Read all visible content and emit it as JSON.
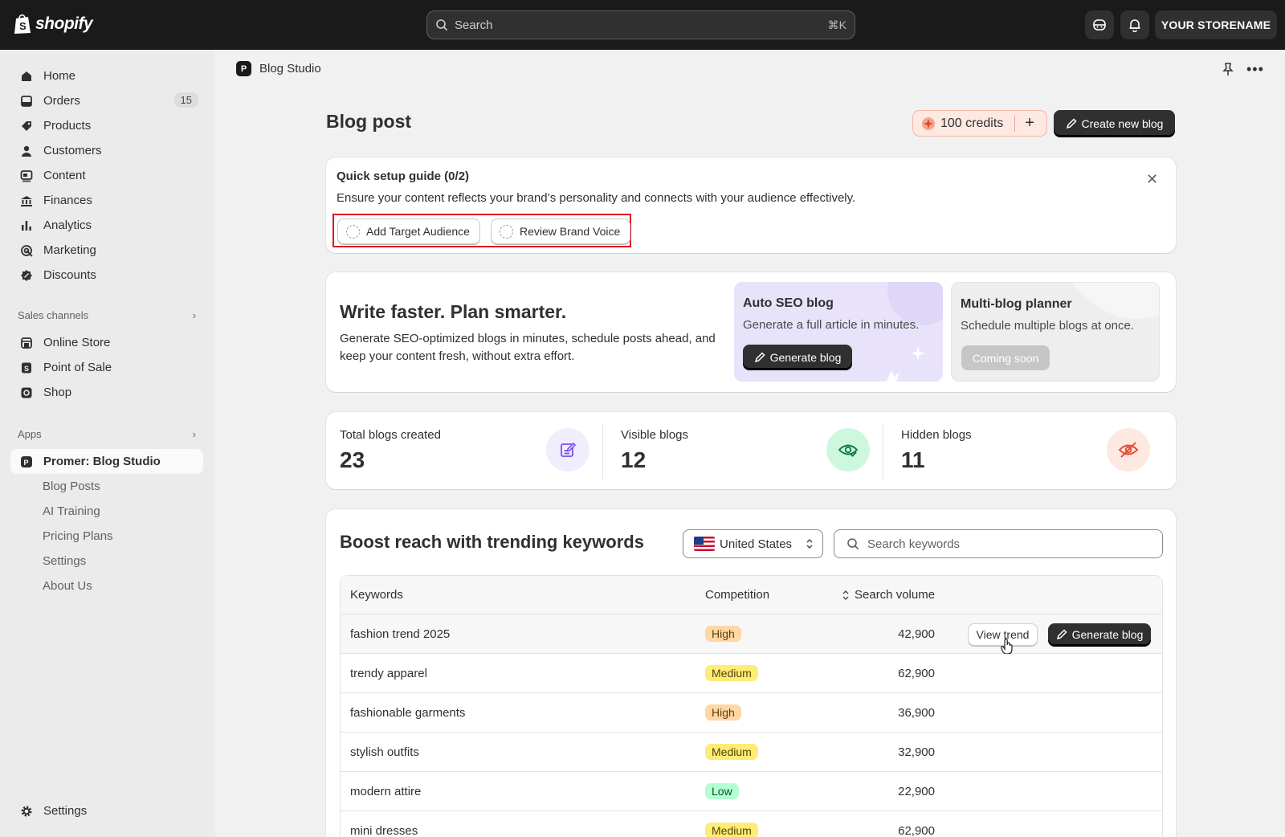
{
  "topbar": {
    "brand": "shopify",
    "search_placeholder": "Search",
    "search_shortcut": "⌘K",
    "store_name": "YOUR STORENAME"
  },
  "sidebar": {
    "items": [
      {
        "label": "Home",
        "icon": "home-icon"
      },
      {
        "label": "Orders",
        "icon": "orders-icon",
        "badge": "15"
      },
      {
        "label": "Products",
        "icon": "tag-icon"
      },
      {
        "label": "Customers",
        "icon": "person-icon"
      },
      {
        "label": "Content",
        "icon": "content-icon"
      },
      {
        "label": "Finances",
        "icon": "bank-icon"
      },
      {
        "label": "Analytics",
        "icon": "bar-chart-icon"
      },
      {
        "label": "Marketing",
        "icon": "target-icon"
      },
      {
        "label": "Discounts",
        "icon": "discount-icon"
      }
    ],
    "sales_channels_label": "Sales channels",
    "channels": [
      {
        "label": "Online Store",
        "icon": "store-icon"
      },
      {
        "label": "Point of Sale",
        "icon": "pos-icon"
      },
      {
        "label": "Shop",
        "icon": "shop-icon"
      }
    ],
    "apps_label": "Apps",
    "app_active": "Promer: Blog Studio",
    "app_sub": [
      "Blog Posts",
      "AI Training",
      "Pricing Plans",
      "Settings",
      "About Us"
    ],
    "settings": "Settings"
  },
  "page": {
    "app_name": "Blog Studio",
    "title": "Blog post",
    "credits": "100 credits",
    "create_button": "Create new blog"
  },
  "guide": {
    "title": "Quick setup guide (0/2)",
    "description": "Ensure your content reflects your brand’s personality and connects with your audience effectively.",
    "step1": "Add Target Audience",
    "step2": "Review Brand Voice"
  },
  "hero": {
    "title": "Write faster. Plan smarter.",
    "text": "Generate SEO-optimized blogs in minutes, schedule posts ahead, and keep your content fresh, without extra effort.",
    "feature1_title": "Auto SEO blog",
    "feature1_desc": "Generate a full article in minutes.",
    "feature1_button": "Generate blog",
    "feature2_title": "Multi-blog planner",
    "feature2_desc": "Schedule multiple blogs at once.",
    "feature2_button": "Coming soon"
  },
  "stats": [
    {
      "label": "Total blogs created",
      "value": "23",
      "color": "#f0eefc"
    },
    {
      "label": "Visible blogs",
      "value": "12",
      "color": "#cdf7df"
    },
    {
      "label": "Hidden blogs",
      "value": "11",
      "color": "#fde8e2"
    }
  ],
  "keywords": {
    "title": "Boost reach with trending keywords",
    "country": "United States",
    "search_placeholder": "Search keywords",
    "columns": {
      "keyword": "Keywords",
      "competition": "Competition",
      "volume": "Search volume"
    },
    "view_trend": "View trend",
    "generate": "Generate blog",
    "rows": [
      {
        "keyword": "fashion trend 2025",
        "competition": "High",
        "volume": "42,900"
      },
      {
        "keyword": "trendy apparel",
        "competition": "Medium",
        "volume": "62,900"
      },
      {
        "keyword": "fashionable garments",
        "competition": "High",
        "volume": "36,900"
      },
      {
        "keyword": "stylish outfits",
        "competition": "Medium",
        "volume": "32,900"
      },
      {
        "keyword": "modern attire",
        "competition": "Low",
        "volume": "22,900"
      },
      {
        "keyword": "mini dresses",
        "competition": "Medium",
        "volume": "62,900"
      }
    ]
  }
}
